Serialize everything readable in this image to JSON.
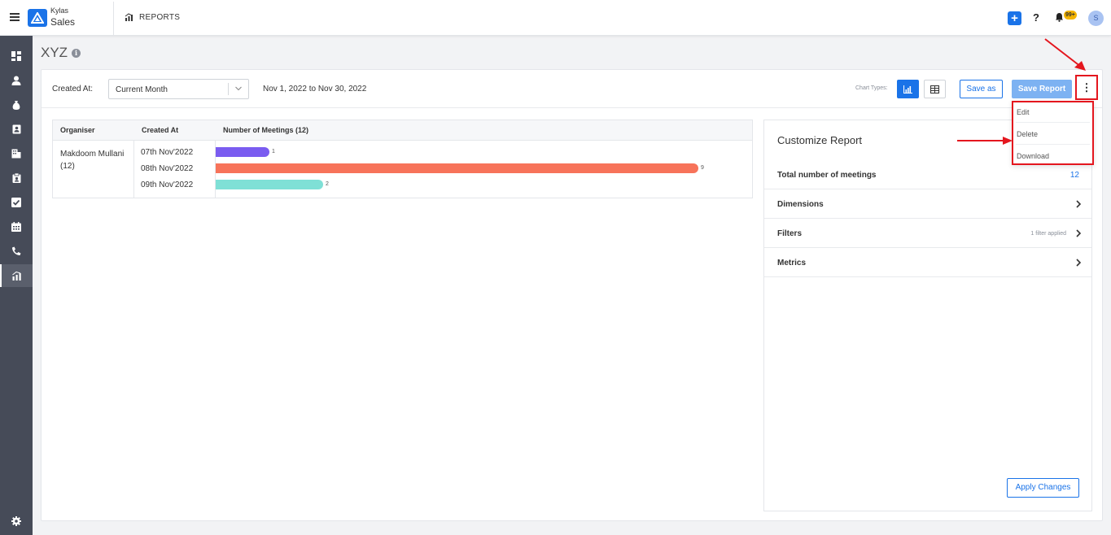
{
  "app": {
    "brand_small": "Kylas",
    "brand_name": "Sales",
    "module_title": "REPORTS",
    "notif_count": "99+",
    "user_initial": "S"
  },
  "report": {
    "title": "XYZ",
    "filter_label": "Created At:",
    "filter_value": "Current Month",
    "date_range": "Nov 1, 2022 to Nov 30, 2022",
    "chart_types_label": "Chart Types:",
    "save_as_label": "Save as",
    "save_report_label": "Save Report"
  },
  "menu": {
    "items": [
      "Edit",
      "Delete",
      "Download"
    ]
  },
  "table": {
    "headers": [
      "Organiser",
      "Created At",
      "Number of Meetings (12)"
    ],
    "organiser": "Makdoom Mullani (12)",
    "rows": [
      {
        "date": "07th Nov'2022",
        "value": 1,
        "color": "#7a5cf0"
      },
      {
        "date": "08th Nov'2022",
        "value": 9,
        "color": "#f7735a"
      },
      {
        "date": "09th Nov'2022",
        "value": 2,
        "color": "#7fe0d6"
      }
    ]
  },
  "chart_data": {
    "type": "bar",
    "categories": [
      "07th Nov'2022",
      "08th Nov'2022",
      "09th Nov'2022"
    ],
    "values": [
      1,
      9,
      2
    ],
    "title": "",
    "xlabel": "Number of Meetings (12)",
    "ylabel": "Created At"
  },
  "customize": {
    "title": "Customize Report",
    "total_label": "Total number of meetings",
    "total_value": "12",
    "dimensions_label": "Dimensions",
    "filters_label": "Filters",
    "filters_meta": "1 filter applied",
    "metrics_label": "Metrics",
    "apply_label": "Apply Changes"
  },
  "colors": {
    "accent": "#1a73e8",
    "sidebar": "#464b58",
    "annotation": "#e4161e"
  },
  "icons": {
    "sidebar": [
      "dashboard-icon",
      "person-icon",
      "money-bag-icon",
      "contact-card-icon",
      "building-icon",
      "clipboard-icon",
      "checkbox-icon",
      "calendar-icon",
      "phone-icon",
      "reports-icon"
    ],
    "footer": "gear-icon"
  }
}
